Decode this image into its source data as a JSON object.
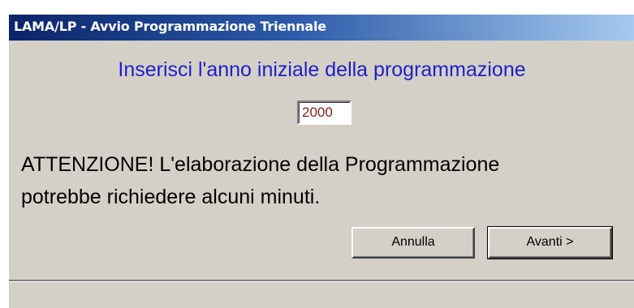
{
  "window": {
    "title": "LAMA/LP - Avvio Programmazione Triennale"
  },
  "dialog": {
    "prompt": "Inserisci l'anno iniziale della programmazione",
    "year_value": "2000",
    "warning_line1": "ATTENZIONE! L'elaborazione della Programmazione",
    "warning_line2": "potrebbe richiedere alcuni minuti."
  },
  "buttons": {
    "cancel_label": "Annulla",
    "next_label": "Avanti >"
  },
  "status_bar": {
    "text": ""
  },
  "colors": {
    "titlebar_start": "#0a246a",
    "titlebar_end": "#a6caf0",
    "prompt_text": "#1f1fc8",
    "year_text": "#8b1a1a",
    "window_bg": "#d4d0c8"
  }
}
